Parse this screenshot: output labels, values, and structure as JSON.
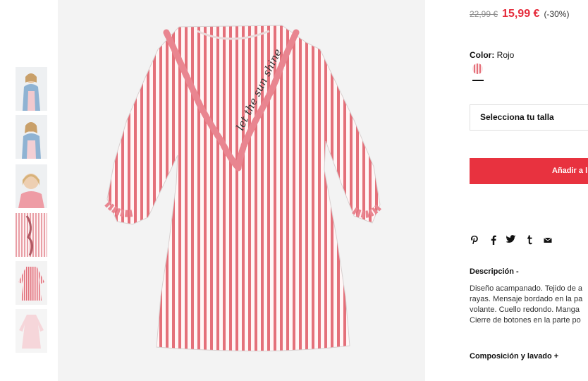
{
  "product": {
    "old_price": "22,99 €",
    "new_price": "15,99 €",
    "discount": "(-30%)",
    "color_label": "Color:",
    "color_value": "Rojo",
    "size_placeholder": "Selecciona tu talla",
    "add_to_bag": "Añadir a l",
    "description_title": "Descripción -",
    "description_lines": [
      "Diseño acampanado. Tejido de a",
      "rayas. Mensaje bordado en la pa",
      "volante. Cuello redondo. Manga",
      "Cierre de botones en la parte po"
    ],
    "composition_title": "Composición y lavado +",
    "embroidery_text": "let the sun shine"
  },
  "share_icons": [
    "pinterest-icon",
    "facebook-icon",
    "twitter-icon",
    "tumblr-icon",
    "mail-icon"
  ],
  "thumbnails": [
    "denim-jacket-front",
    "denim-jacket-side",
    "girl-portrait",
    "ruffle-detail",
    "dress-flat-red",
    "dress-flat-pink"
  ],
  "colors": {
    "price_red": "#e52a3a",
    "button_red": "#e8323f",
    "stripe_red": "#e4707a",
    "image_bg": "#f3f3f3"
  }
}
